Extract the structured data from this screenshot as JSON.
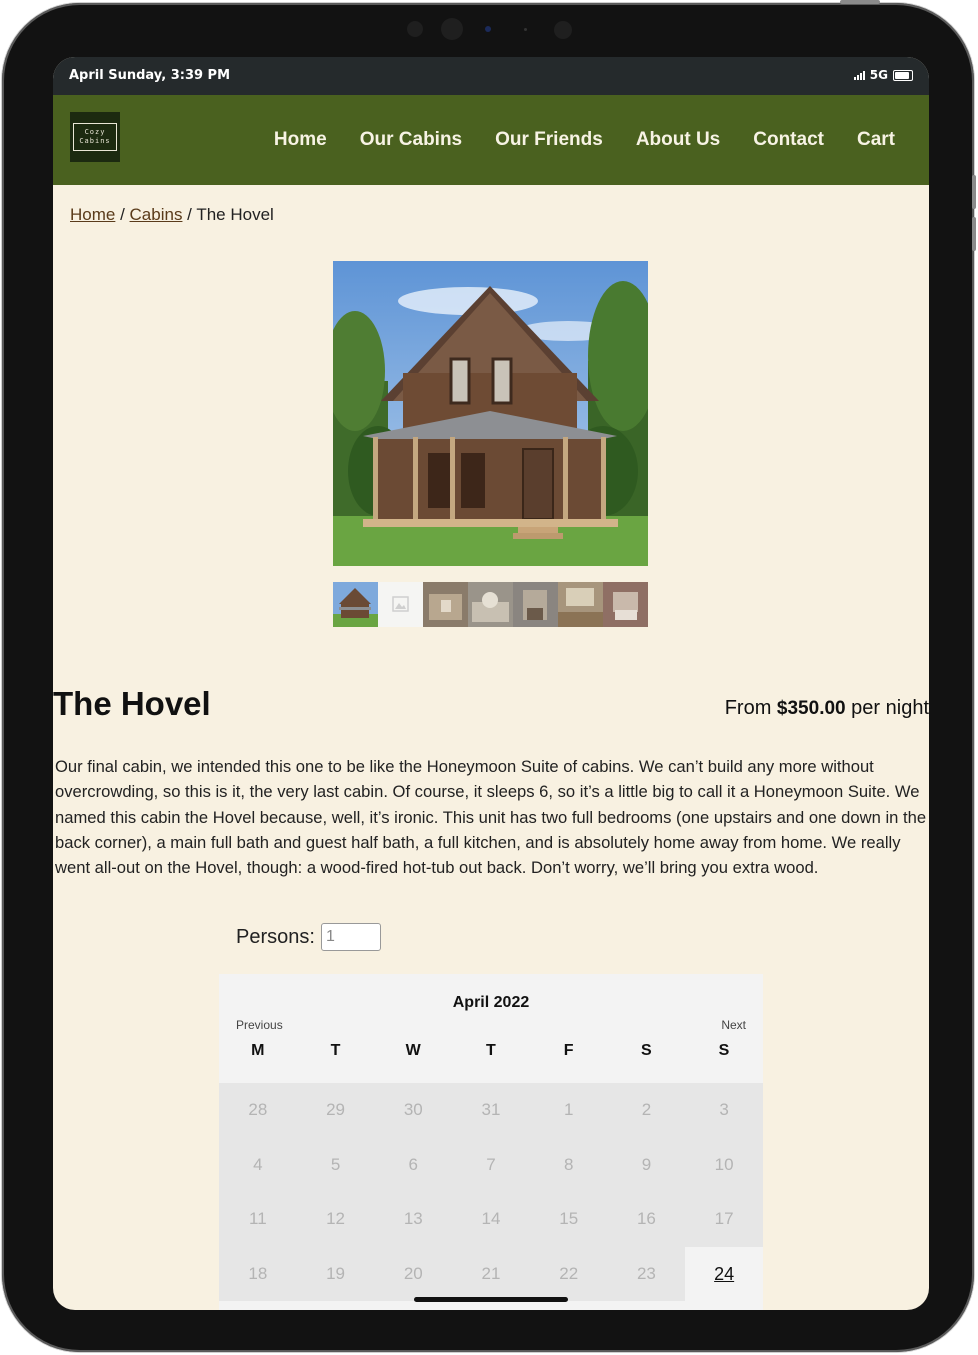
{
  "status_bar": {
    "time": "April Sunday, 3:39 PM",
    "network": "5G"
  },
  "brand": {
    "logo_line1": "Cozy",
    "logo_line2": "Cabins"
  },
  "nav": {
    "items": [
      "Home",
      "Our Cabins",
      "Our Friends",
      "About Us",
      "Contact",
      "Cart"
    ]
  },
  "breadcrumb": {
    "home": "Home",
    "sep1": " / ",
    "cabins": "Cabins",
    "sep2": " / ",
    "current": "The Hovel"
  },
  "cabin": {
    "title": "The Hovel",
    "price_prefix": "From ",
    "price": "$350.00",
    "price_suffix": " per night",
    "description": "Our final cabin, we intended this one to be like the Honeymoon Suite of cabins. We can’t build any more without overcrowding, so this is it, the very last cabin. Of course, it sleeps 6, so it’s a little big to call it a Honeymoon Suite. We named this cabin the Hovel because, well, it’s ironic. This unit has two full bedrooms (one upstairs and one down in the back corner), a main full bath and guest half bath, a full kitchen, and is absolutely home away from home. We really went all-out on the Hovel, though: a wood-fired hot-tub out back. Don’t worry, we’ll bring you extra wood."
  },
  "booking": {
    "persons_label": "Persons:",
    "persons_value": "1"
  },
  "calendar": {
    "month": "April 2022",
    "prev_label": "Previous",
    "next_label": "Next",
    "weekdays": [
      "M",
      "T",
      "W",
      "T",
      "F",
      "S",
      "S"
    ],
    "days": [
      "28",
      "29",
      "30",
      "31",
      "1",
      "2",
      "3",
      "4",
      "5",
      "6",
      "7",
      "8",
      "9",
      "10",
      "11",
      "12",
      "13",
      "14",
      "15",
      "16",
      "17",
      "18",
      "19",
      "20",
      "21",
      "22",
      "23",
      "24"
    ],
    "today": "24"
  },
  "colors": {
    "nav_bg": "#4a611f",
    "page_bg": "#f8f1e1",
    "status_bg": "#252a2c",
    "link": "#5a3b1a"
  },
  "icons": [
    "signal-icon",
    "battery-icon",
    "image-placeholder-icon"
  ]
}
